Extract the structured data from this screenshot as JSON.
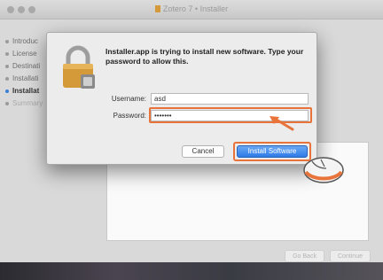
{
  "installer": {
    "title": "Zotero 7 • Installer",
    "sidebar": [
      {
        "label": "Introduc",
        "state": "normal"
      },
      {
        "label": "License",
        "state": "normal"
      },
      {
        "label": "Destinati",
        "state": "normal"
      },
      {
        "label": "Installati",
        "state": "normal"
      },
      {
        "label": "Installat",
        "state": "active"
      },
      {
        "label": "Summary",
        "state": "dim"
      }
    ],
    "go_back_label": "Go Back",
    "continue_label": "Continue"
  },
  "auth_dialog": {
    "message": "Installer.app is trying to install new software. Type your password to allow this.",
    "username_label": "Username:",
    "username_value": "asd",
    "password_label": "Password:",
    "password_value": "•••••••",
    "cancel_label": "Cancel",
    "install_label": "Install Software"
  },
  "colors": {
    "highlight": "#e8743b",
    "install_button": "#2f7be8",
    "lock": "#d49a3a"
  },
  "icons": [
    "lock-icon",
    "pointer-arrow-icon",
    "mouse-icon"
  ]
}
